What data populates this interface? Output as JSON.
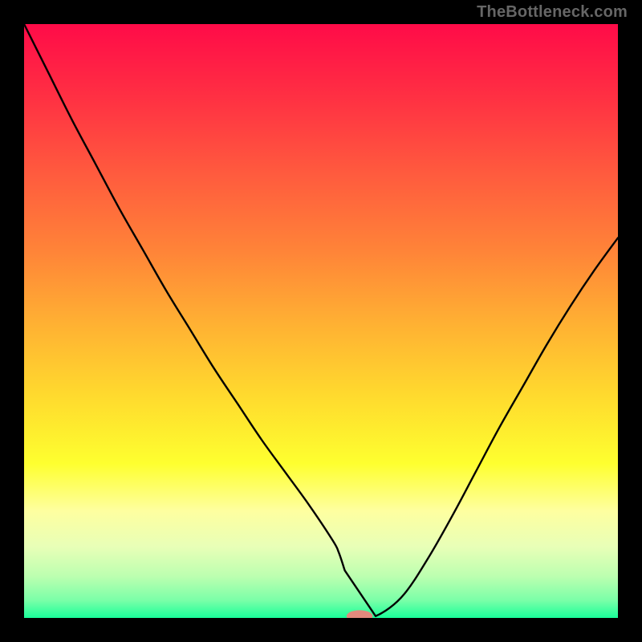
{
  "watermark": "TheBottleneck.com",
  "colors": {
    "background": "#000000",
    "curve": "#000000",
    "marker": "#e2897d",
    "gradient_stops": [
      {
        "offset": 0.0,
        "color": "#ff0b48"
      },
      {
        "offset": 0.12,
        "color": "#ff2f43"
      },
      {
        "offset": 0.25,
        "color": "#ff5a3e"
      },
      {
        "offset": 0.38,
        "color": "#ff8338"
      },
      {
        "offset": 0.5,
        "color": "#ffaf33"
      },
      {
        "offset": 0.62,
        "color": "#ffd82e"
      },
      {
        "offset": 0.74,
        "color": "#feff2f"
      },
      {
        "offset": 0.82,
        "color": "#feffa0"
      },
      {
        "offset": 0.88,
        "color": "#e8ffb7"
      },
      {
        "offset": 0.93,
        "color": "#bcffb0"
      },
      {
        "offset": 0.97,
        "color": "#7bffa8"
      },
      {
        "offset": 1.0,
        "color": "#1aff9a"
      }
    ]
  },
  "chart_data": {
    "type": "line",
    "title": "",
    "xlabel": "",
    "ylabel": "",
    "xlim": [
      0,
      100
    ],
    "ylim": [
      0,
      100
    ],
    "x": [
      0,
      4,
      8,
      12,
      16,
      20,
      24,
      28,
      32,
      36,
      40,
      44,
      48,
      52,
      53,
      54,
      55,
      56,
      57,
      58,
      60,
      64,
      68,
      72,
      76,
      80,
      84,
      88,
      92,
      96,
      100
    ],
    "values": [
      100,
      92,
      84,
      76.5,
      69,
      62,
      55,
      48.5,
      42,
      36,
      30,
      24.5,
      19,
      13,
      11,
      8,
      4,
      1.5,
      0.5,
      0.3,
      0.3,
      4,
      10,
      17,
      24.5,
      32,
      39,
      46,
      52.5,
      58.5,
      64
    ],
    "marker": {
      "x": 56.5,
      "y": 0.3,
      "rx": 2.2,
      "ry": 1.0
    },
    "flat_range": [
      54.2,
      59.2
    ]
  }
}
